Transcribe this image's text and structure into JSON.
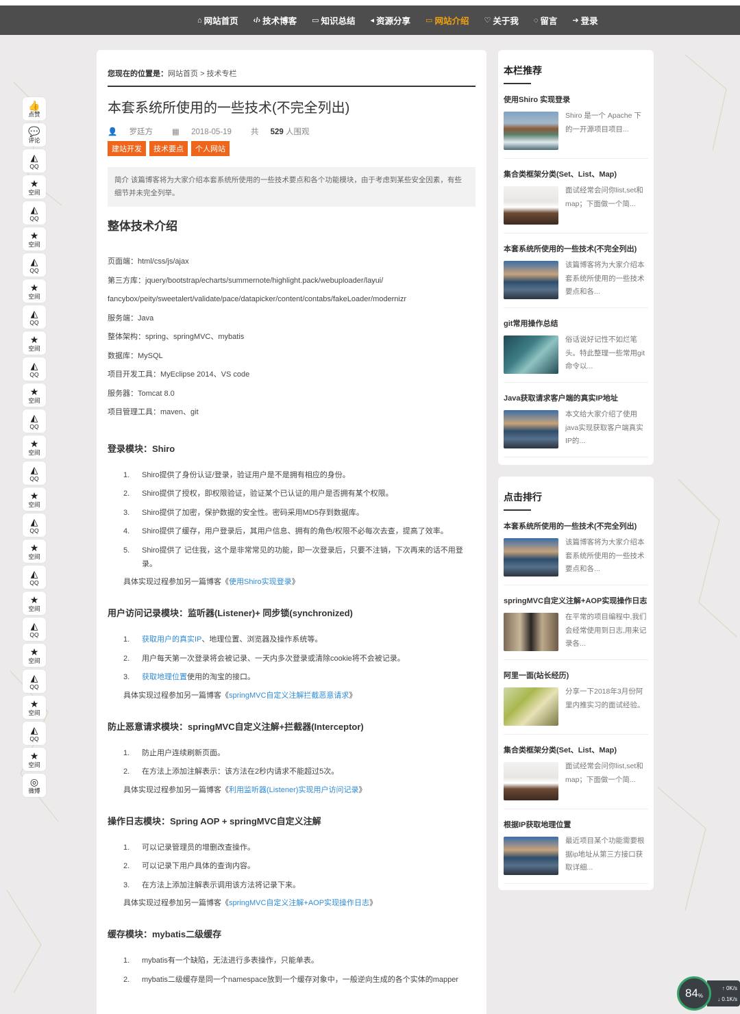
{
  "nav": [
    {
      "icon": "home-icon",
      "glyph": "⌂",
      "label": "网站首页"
    },
    {
      "icon": "code-icon",
      "glyph": "‹/›",
      "label": "技术博客"
    },
    {
      "icon": "folder-icon",
      "glyph": "▭",
      "label": "知识总结"
    },
    {
      "icon": "share-icon",
      "glyph": "◂",
      "label": "资源分享"
    },
    {
      "icon": "monitor-icon",
      "glyph": "▭",
      "label": "网站介绍",
      "active": true
    },
    {
      "icon": "heart-icon",
      "glyph": "♡",
      "label": "关于我"
    },
    {
      "icon": "comment-icon",
      "glyph": "◌",
      "label": "留言"
    },
    {
      "icon": "login-icon",
      "glyph": "➔",
      "label": "登录"
    }
  ],
  "side_share": [
    {
      "icon": "thumbs-up-icon",
      "glyph": "👍",
      "label": "点赞"
    },
    {
      "icon": "comment-icon",
      "glyph": "💬",
      "label": "评论"
    },
    {
      "icon": "qq-icon",
      "glyph": "◭",
      "label": "QQ"
    },
    {
      "icon": "star-icon",
      "glyph": "★",
      "label": "空间"
    },
    {
      "icon": "qq-icon",
      "glyph": "◭",
      "label": "QQ"
    },
    {
      "icon": "star-icon",
      "glyph": "★",
      "label": "空间"
    },
    {
      "icon": "qq-icon",
      "glyph": "◭",
      "label": "QQ"
    },
    {
      "icon": "star-icon",
      "glyph": "★",
      "label": "空间"
    },
    {
      "icon": "qq-icon",
      "glyph": "◭",
      "label": "QQ"
    },
    {
      "icon": "star-icon",
      "glyph": "★",
      "label": "空间"
    },
    {
      "icon": "qq-icon",
      "glyph": "◭",
      "label": "QQ"
    },
    {
      "icon": "star-icon",
      "glyph": "★",
      "label": "空间"
    },
    {
      "icon": "qq-icon",
      "glyph": "◭",
      "label": "QQ"
    },
    {
      "icon": "star-icon",
      "glyph": "★",
      "label": "空间"
    },
    {
      "icon": "qq-icon",
      "glyph": "◭",
      "label": "QQ"
    },
    {
      "icon": "star-icon",
      "glyph": "★",
      "label": "空间"
    },
    {
      "icon": "qq-icon",
      "glyph": "◭",
      "label": "QQ"
    },
    {
      "icon": "star-icon",
      "glyph": "★",
      "label": "空间"
    },
    {
      "icon": "qq-icon",
      "glyph": "◭",
      "label": "QQ"
    },
    {
      "icon": "star-icon",
      "glyph": "★",
      "label": "空间"
    },
    {
      "icon": "qq-icon",
      "glyph": "◭",
      "label": "QQ"
    },
    {
      "icon": "star-icon",
      "glyph": "★",
      "label": "空间"
    },
    {
      "icon": "qq-icon",
      "glyph": "◭",
      "label": "QQ"
    },
    {
      "icon": "star-icon",
      "glyph": "★",
      "label": "空间"
    },
    {
      "icon": "qq-icon",
      "glyph": "◭",
      "label": "QQ"
    },
    {
      "icon": "star-icon",
      "glyph": "★",
      "label": "空间"
    },
    {
      "icon": "weibo-icon",
      "glyph": "◎",
      "label": "微博"
    }
  ],
  "article": {
    "breadcrumb_label": "您现在的位置是：",
    "breadcrumb_home": "网站首页",
    "breadcrumb_sep": ">",
    "breadcrumb_current": "技术专栏",
    "title": "本套系统所使用的一些技术(不完全列出)",
    "author": "罗廷方",
    "date": "2018-05-19",
    "views_prefix": "共",
    "views": "529",
    "views_suffix": "人围观",
    "tags": [
      "建站开发",
      "技术要点",
      "个人网站"
    ],
    "summary": "简介  该篇博客将为大家介绍本套系统所使用的一些技术要点和各个功能模块，由于考虑到某些安全因素，有些细节并未完全列举。",
    "section_title": "整体技术介绍",
    "tech_lines": [
      "页面端：html/css/js/ajax",
      "第三方库：jquery/bootstrap/echarts/summernote/highlight.pack/webuploader/layui/",
      "fancybox/peity/sweetalert/validate/pace/datapicker/content/contabs/fakeLoader/modernizr",
      "服务端：Java",
      "整体架构：spring、springMVC、mybatis",
      "数据库：MySQL",
      "项目开发工具：MyEclipse 2014、VS code",
      "服务器：Tomcat 8.0",
      "项目管理工具：maven、git"
    ],
    "modules": [
      {
        "title": "登录模块：Shiro",
        "items": [
          {
            "n": "1.",
            "text": "Shiro提供了身份认证/登录，验证用户是不是拥有相应的身份。"
          },
          {
            "n": "2.",
            "text": "Shiro提供了授权，即权限验证，验证某个已认证的用户是否拥有某个权限。"
          },
          {
            "n": "3.",
            "text": "Shiro提供了加密，保护数据的安全性。密码采用MD5存到数据库。"
          },
          {
            "n": "4.",
            "text": "Shiro提供了缓存，用户登录后，其用户信息、拥有的角色/权限不必每次去查，提高了效率。"
          },
          {
            "n": "5.",
            "text": "Shiro提供了 记住我，这个是非常常见的功能，即一次登录后，只要不注销，下次再来的话不用登录。"
          }
        ],
        "ref_prefix": "具体实现过程参加另一篇博客《",
        "ref_link": "使用Shiro实现登录",
        "ref_suffix": "》"
      },
      {
        "title": "用户访问记录模块：监听器(Listener)+ 同步锁(synchronized)",
        "items": [
          {
            "n": "1.",
            "link": "获取用户的真实IP",
            "text": "、地理位置、浏览器及操作系统等。"
          },
          {
            "n": "2.",
            "text": "用户每天第一次登录将会被记录、一天内多次登录或清除cookie将不会被记录。"
          },
          {
            "n": "3.",
            "link": "获取地理位置",
            "text": "使用的淘宝的接口。"
          }
        ],
        "ref_prefix": "具体实现过程参加另一篇博客《",
        "ref_link": "springMVC自定义注解拦截恶意请求",
        "ref_suffix": "》"
      },
      {
        "title": "防止恶意请求模块：springMVC自定义注解+拦截器(Interceptor)",
        "items": [
          {
            "n": "1.",
            "text": "防止用户连续刷新页面。"
          },
          {
            "n": "2.",
            "text": "在方法上添加注解表示：该方法在2秒内请求不能超过5次。"
          }
        ],
        "ref_prefix": "具体实现过程参加另一篇博客《",
        "ref_link": "利用监听器(Listener)实现用户访问记录",
        "ref_suffix": "》"
      },
      {
        "title": "操作日志模块：Spring AOP + springMVC自定义注解",
        "items": [
          {
            "n": "1.",
            "text": "可以记录管理员的增删改查操作。"
          },
          {
            "n": "2.",
            "text": "可以记录下用户具体的查询内容。"
          },
          {
            "n": "3.",
            "text": "在方法上添加注解表示调用该方法将记录下来。"
          }
        ],
        "ref_prefix": "具体实现过程参加另一篇博客《",
        "ref_link": "springMVC自定义注解+AOP实现操作日志",
        "ref_suffix": "》"
      },
      {
        "title": "缓存模块：mybatis二级缓存",
        "items": [
          {
            "n": "1.",
            "text": "mybatis有一个缺陷，无法进行多表操作，只能单表。"
          },
          {
            "n": "2.",
            "text": "mybatis二级缓存是同一个namespace放到一个缓存对象中，一般逆向生成的各个实体的mapper"
          }
        ]
      }
    ]
  },
  "recommend": {
    "title": "本栏推荐",
    "items": [
      {
        "h": "使用Shiro 实现登录",
        "d": "Shiro 是一个 Apache 下的一开源项目项目...",
        "thumb": "th-sea"
      },
      {
        "h": "集合类框架分类(Set、List、Map)",
        "d": "面试经常会问你list,set和map；下面做一个简...",
        "thumb": "th-bed"
      },
      {
        "h": "本套系统所使用的一些技术(不完全列出)",
        "d": "该篇博客将为大家介绍本套系统所使用的一些技术要点和各...",
        "thumb": "th-city"
      },
      {
        "h": "git常用操作总结",
        "d": "俗话说好记性不如烂笔头。特此整理一些常用git命令以...",
        "thumb": "th-drop"
      },
      {
        "h": "Java获取请求客户端的真实IP地址",
        "d": "本文给大家介绍了使用java实现获取客户端真实IP的...",
        "thumb": "th-city"
      }
    ]
  },
  "ranking": {
    "title": "点击排行",
    "items": [
      {
        "h": "本套系统所使用的一些技术(不完全列出)",
        "d": "该篇博客将为大家介绍本套系统所使用的一些技术要点和各...",
        "thumb": "th-city"
      },
      {
        "h": "springMVC自定义注解+AOP实现操作日志",
        "d": "在平常的项目编程中,我们会经常使用到日志,用来记录各...",
        "thumb": "th-walk"
      },
      {
        "h": "阿里一面(站长经历)",
        "d": "分享一下2018年3月份阿里内推实习的面试经验。",
        "thumb": "th-leaf"
      },
      {
        "h": "集合类框架分类(Set、List、Map)",
        "d": "面试经常会问你list,set和map；下面做一个简...",
        "thumb": "th-bed"
      },
      {
        "h": "根据IP获取地理位置",
        "d": "最近项目某个功能需要根据ip地址从第三方接口获取详细...",
        "thumb": "th-city"
      }
    ]
  },
  "speed": {
    "percent": "84",
    "unit": "%",
    "up": "0K/s",
    "down": "0.1K/s"
  }
}
